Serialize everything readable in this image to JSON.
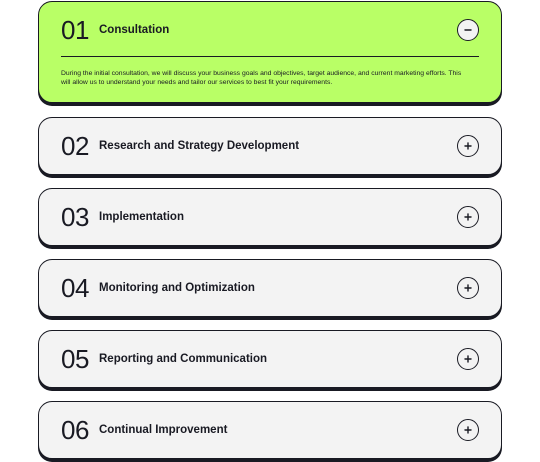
{
  "accordion": {
    "items": [
      {
        "number": "01",
        "title": "Consultation",
        "expanded": true,
        "toggle_icon": "minus-icon",
        "description": "During the initial consultation, we will discuss your business goals and objectives, target audience, and current marketing efforts. This will allow us to understand your needs and tailor our services to best fit your requirements."
      },
      {
        "number": "02",
        "title": "Research and Strategy Development",
        "expanded": false,
        "toggle_icon": "plus-icon"
      },
      {
        "number": "03",
        "title": "Implementation",
        "expanded": false,
        "toggle_icon": "plus-icon"
      },
      {
        "number": "04",
        "title": "Monitoring and Optimization",
        "expanded": false,
        "toggle_icon": "plus-icon"
      },
      {
        "number": "05",
        "title": "Reporting and Communication",
        "expanded": false,
        "toggle_icon": "plus-icon"
      },
      {
        "number": "06",
        "title": "Continual Improvement",
        "expanded": false,
        "toggle_icon": "plus-icon"
      }
    ]
  },
  "colors": {
    "accent": "#b9ff66",
    "card_background": "#f3f3f3",
    "dark": "#191a23"
  }
}
